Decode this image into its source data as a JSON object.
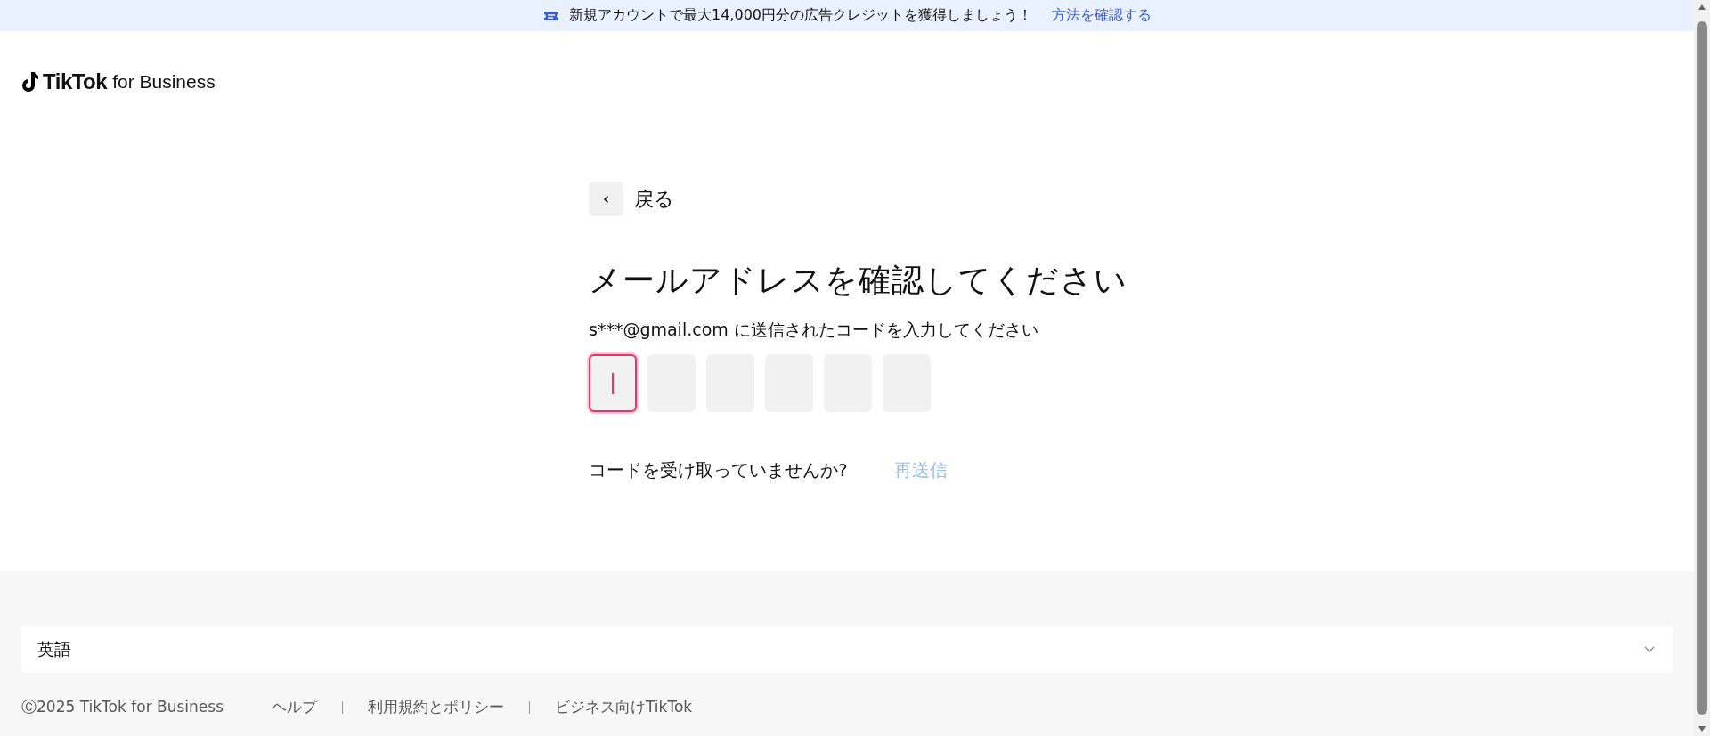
{
  "banner": {
    "text": "新規アカウントで最大14,000円分の広告クレジットを獲得しましょう！",
    "link": "方法を確認する"
  },
  "logo": {
    "brand": "TikTok",
    "suffix": "for Business"
  },
  "back": {
    "label": "戻る"
  },
  "title": "メールアドレスを確認してください",
  "subtitle": {
    "email": "s***@gmail.com",
    "text": "に送信されたコードを入力してください"
  },
  "code_boxes": [
    {
      "selected": true
    },
    {
      "selected": false
    },
    {
      "selected": false
    },
    {
      "selected": false
    },
    {
      "selected": false
    },
    {
      "selected": false
    }
  ],
  "resend": {
    "question": "コードを受け取っていませんか?",
    "link": "再送信",
    "disabled": true
  },
  "footer": {
    "language": "英語",
    "copyright": "Ⓒ2025 TikTok for Business",
    "links": [
      "ヘルプ",
      "利用規約とポリシー",
      "ビジネス向けTikTok"
    ]
  }
}
